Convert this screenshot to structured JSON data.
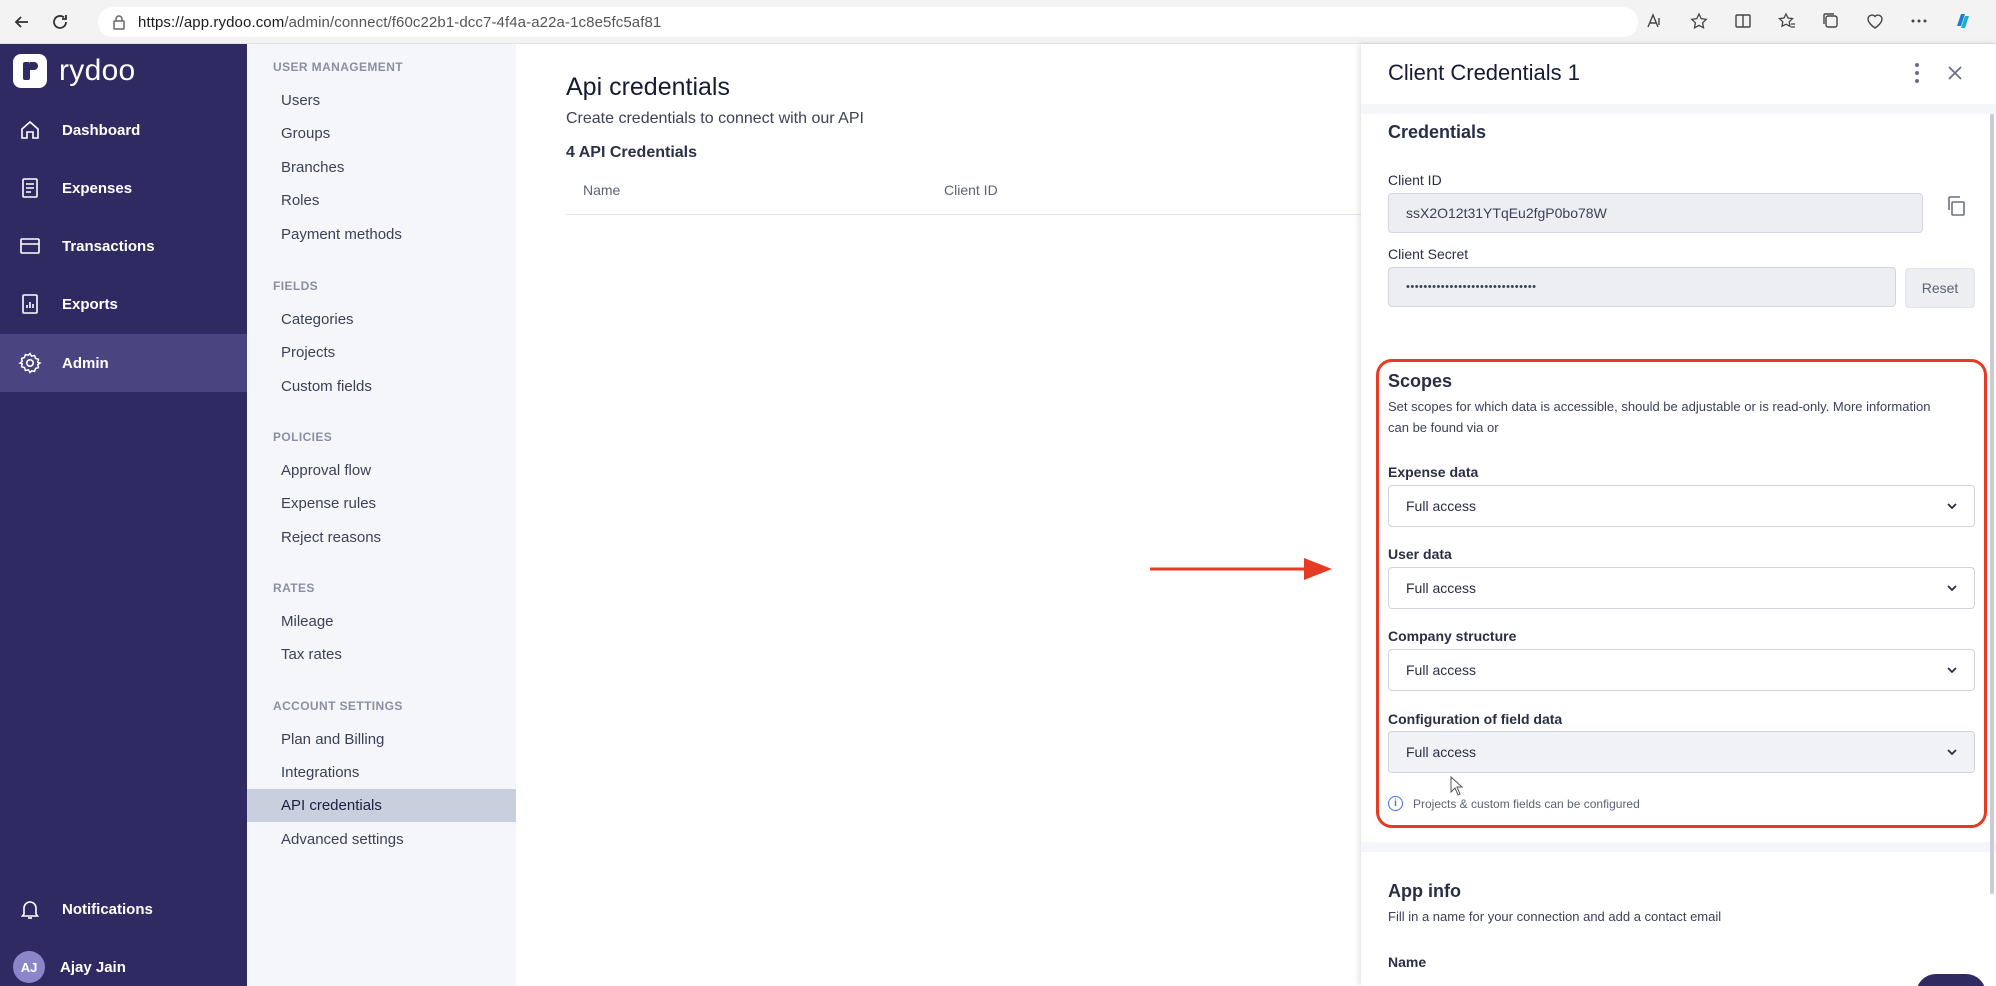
{
  "browser": {
    "url_host": "https://app.rydoo.com",
    "url_path": "/admin/connect/f60c22b1-dcc7-4f4a-a22a-1c8e5fc5af81"
  },
  "sidebar": {
    "logo": "rydoo",
    "items": [
      {
        "label": "Dashboard",
        "icon": "home-icon"
      },
      {
        "label": "Expenses",
        "icon": "receipt-icon"
      },
      {
        "label": "Transactions",
        "icon": "card-icon"
      },
      {
        "label": "Exports",
        "icon": "export-icon"
      },
      {
        "label": "Admin",
        "icon": "gear-icon",
        "active": true
      }
    ],
    "notifications_label": "Notifications",
    "user": {
      "initials": "AJ",
      "name": "Ajay Jain"
    }
  },
  "submenu": {
    "sections": [
      {
        "heading": "USER MANAGEMENT",
        "items": [
          "Users",
          "Groups",
          "Branches",
          "Roles",
          "Payment methods"
        ]
      },
      {
        "heading": "FIELDS",
        "items": [
          "Categories",
          "Projects",
          "Custom fields"
        ]
      },
      {
        "heading": "POLICIES",
        "items": [
          "Approval flow",
          "Expense rules",
          "Reject reasons"
        ]
      },
      {
        "heading": "RATES",
        "items": [
          "Mileage",
          "Tax rates"
        ]
      },
      {
        "heading": "ACCOUNT SETTINGS",
        "items": [
          "Plan and Billing",
          "Integrations",
          "API credentials",
          "Advanced settings"
        ]
      }
    ]
  },
  "main": {
    "title": "Api credentials",
    "subtitle": "Create credentials to connect with our API",
    "count": "4 API Credentials",
    "columns": [
      "Name",
      "Client ID"
    ]
  },
  "drawer": {
    "title": "Client Credentials 1",
    "credentials_heading": "Credentials",
    "client_id_label": "Client ID",
    "client_id_value": "ssX2O12t31YTqEu2fgP0bo78W",
    "client_secret_label": "Client Secret",
    "client_secret_value": "••••••••••••••••••••••••••••••",
    "reset_label": "Reset",
    "scopes_heading": "Scopes",
    "scopes_desc": "Set scopes for which data is accessible, should be adjustable or is read-only. More information can be found via or",
    "scopes": [
      {
        "label": "Expense data",
        "value": "Full access"
      },
      {
        "label": "User data",
        "value": "Full access"
      },
      {
        "label": "Company structure",
        "value": "Full access"
      },
      {
        "label": "Configuration of field data",
        "value": "Full access"
      }
    ],
    "info_note": "Projects & custom fields can be configured",
    "app_info_heading": "App info",
    "app_info_desc": "Fill in a name for your connection and add a contact email",
    "name_label": "Name"
  },
  "colors": {
    "sidebar_bg": "#302a63",
    "highlight": "#e53a23",
    "submenu_active": "#c9cfdd"
  }
}
